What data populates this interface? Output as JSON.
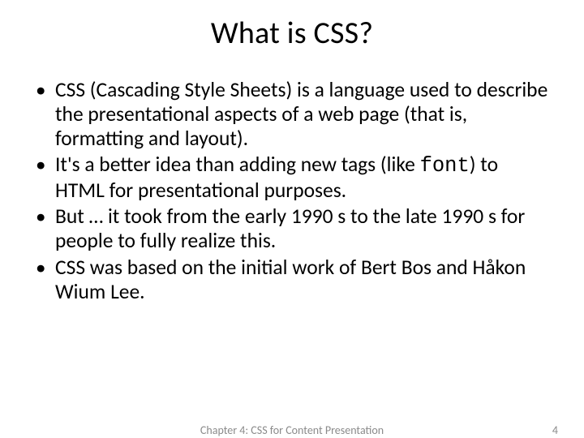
{
  "slide": {
    "title": "What is CSS?",
    "bullets": [
      {
        "pre": "CSS (Cascading Style Sheets) is a language used to describe the presentational aspects of a web page (that is, formatting and layout).",
        "code": "",
        "post": ""
      },
      {
        "pre": "It's a better idea than adding new tags (like ",
        "code": "font",
        "post": ") to HTML for presentational purposes."
      },
      {
        "pre": "But … it took from the early 1990 s to the late 1990 s for people to fully realize this.",
        "code": "",
        "post": ""
      },
      {
        "pre": "CSS was based on the initial work of Bert Bos and Håkon Wium Lee.",
        "code": "",
        "post": ""
      }
    ],
    "footer_center": "Chapter 4: CSS for Content Presentation",
    "page_number": "4"
  }
}
